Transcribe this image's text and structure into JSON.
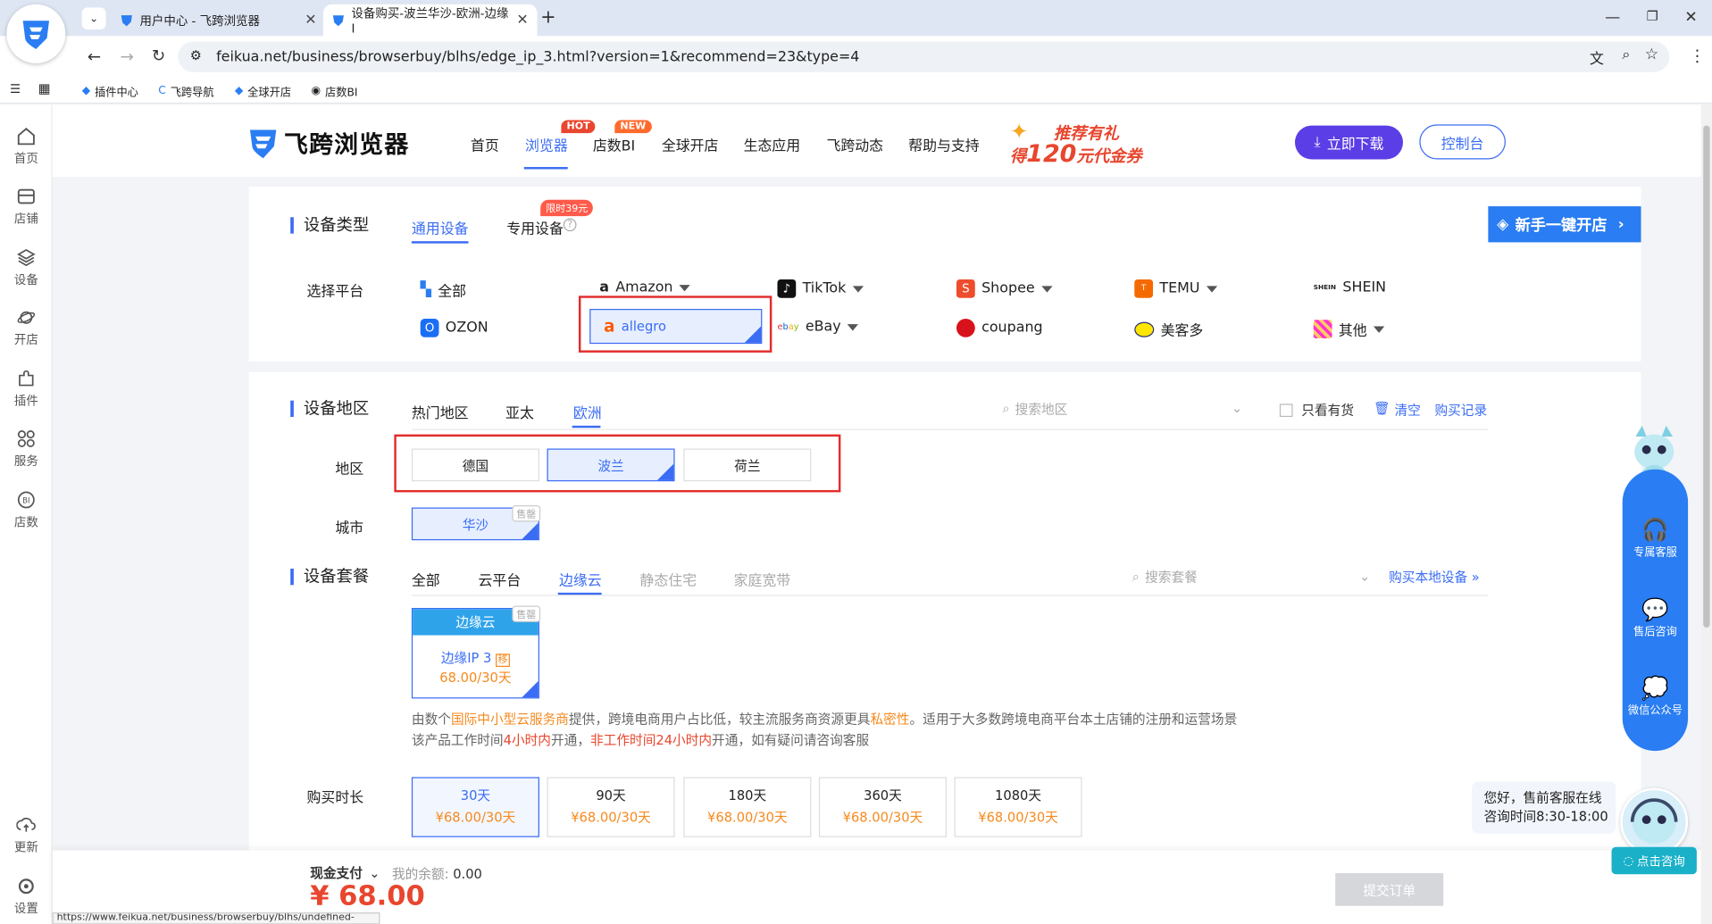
{
  "browser": {
    "tabs": [
      {
        "title": "用户中心 - 飞跨浏览器"
      },
      {
        "title": "设备购买-波兰华沙-欧洲-边缘I"
      }
    ],
    "url": "feikua.net/business/browserbuy/blhs/edge_ip_3.html?version=1&recommend=23&type=4",
    "bookmarks": [
      "插件中心",
      "飞跨导航",
      "全球开店",
      "店数BI"
    ],
    "status_url": "https://www.feikua.net/business/browserbuy/blhs/undefined-"
  },
  "sidebar": {
    "items": [
      {
        "label": "首页"
      },
      {
        "label": "店铺"
      },
      {
        "label": "设备"
      },
      {
        "label": "开店"
      },
      {
        "label": "插件"
      },
      {
        "label": "服务"
      },
      {
        "label": "店数"
      }
    ],
    "bottom": [
      {
        "label": "更新"
      },
      {
        "label": "设置"
      }
    ]
  },
  "header": {
    "logo": "飞跨浏览器",
    "nav": [
      "首页",
      "浏览器",
      "店数BI",
      "全球开店",
      "生态应用",
      "飞跨动态",
      "帮助与支持"
    ],
    "badge_hot": "HOT",
    "badge_new": "NEW",
    "promo_line1": "推荐有礼",
    "promo_pre": "得",
    "promo_num": "120",
    "promo_post": "元代金券",
    "download": "立即下载",
    "console": "控制台"
  },
  "device_type": {
    "title": "设备类型",
    "tabs": [
      "通用设备",
      "专用设备"
    ],
    "limited_badge": "限时39元",
    "new_store_btn": "新手一键开店",
    "platform_label": "选择平台",
    "platforms": [
      "全部",
      "Amazon",
      "TikTok",
      "Shopee",
      "TEMU",
      "SHEIN",
      "OZON",
      "allegro",
      "eBay",
      "coupang",
      "美客多",
      "其他"
    ]
  },
  "region": {
    "title": "设备地区",
    "tabs": [
      "热门地区",
      "亚太",
      "欧洲"
    ],
    "search_placeholder": "搜索地区",
    "only_stock": "只看有货",
    "clear": "清空",
    "history": "购买记录",
    "region_label": "地区",
    "regions": [
      "德国",
      "波兰",
      "荷兰"
    ],
    "city_label": "城市",
    "city": "华沙",
    "sold": "售罄"
  },
  "package": {
    "title": "设备套餐",
    "tabs": [
      "全部",
      "云平台",
      "边缘云",
      "静态住宅",
      "家庭宽带"
    ],
    "search_placeholder": "搜索套餐",
    "local_link": "购买本地设备 »",
    "card_head": "边缘云",
    "card_name": "边缘IP 3",
    "card_tag": "移",
    "card_price": "68.00/30天",
    "desc1_pre": "由数个",
    "desc1_hl": "国际中小型云服务商",
    "desc1_mid": "提供，跨境电商用户占比低，较主流服务商资源更具",
    "desc1_hl2": "私密性",
    "desc1_post": "。适用于大多数跨境电商平台本土店铺的注册和运营场景",
    "desc2_pre": "该产品工作时间",
    "desc2_hl": "4小时内",
    "desc2_mid": "开通，",
    "desc2_hl2": "非工作时间24小时内",
    "desc2_post": "开通，如有疑问请咨询客服"
  },
  "duration": {
    "label": "购买时长",
    "options": [
      {
        "days": "30天",
        "price": "¥68.00/30天"
      },
      {
        "days": "90天",
        "price": "¥68.00/30天"
      },
      {
        "days": "180天",
        "price": "¥68.00/30天"
      },
      {
        "days": "360天",
        "price": "¥68.00/30天"
      },
      {
        "days": "1080天",
        "price": "¥68.00/30天"
      }
    ]
  },
  "footer": {
    "pay_method": "现金支付",
    "balance_label": "我的余额:",
    "balance": "0.00",
    "total": "¥ 68.00",
    "submit": "提交订单"
  },
  "support": {
    "items": [
      "专属客服",
      "售后咨询",
      "微信公众号"
    ],
    "greeting1": "您好，售前客服在线",
    "greeting2": "咨询时间8:30-18:00",
    "consult": "点击咨询"
  },
  "colors": {
    "accent": "#3a6cf4",
    "price": "#f58a1f",
    "total": "#e8462e",
    "download": "#5b3ee6",
    "highlight": "#e22c2c"
  }
}
